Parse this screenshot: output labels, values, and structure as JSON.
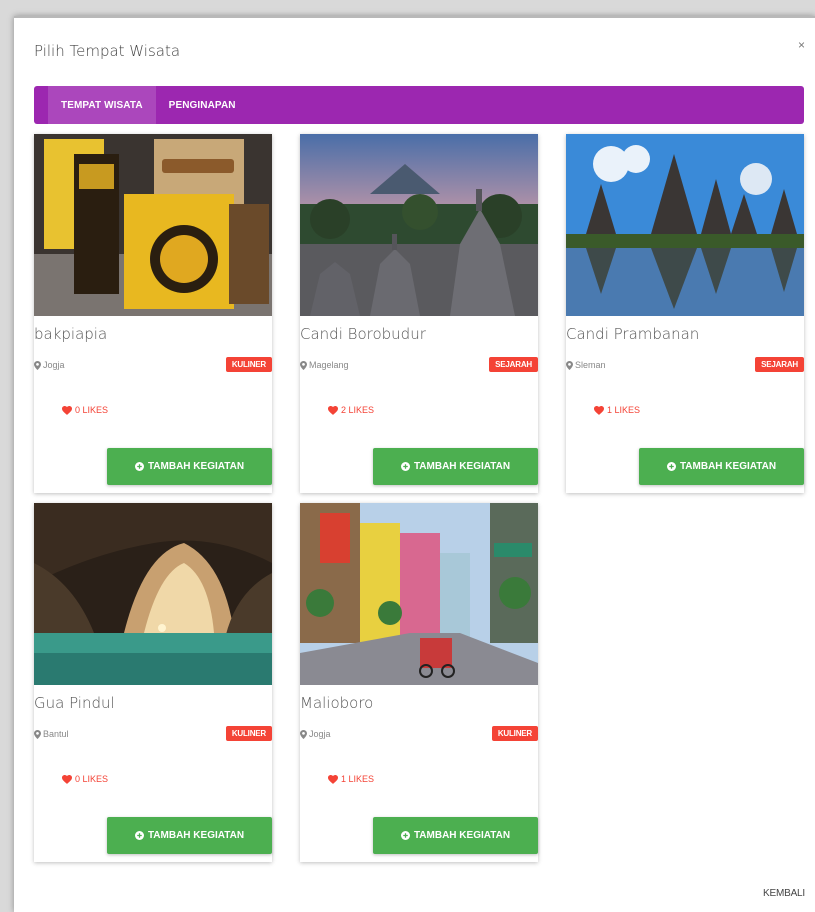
{
  "modal": {
    "title": "Pilih Tempat Wisata",
    "close": "×",
    "footer_button": "KEMBALI"
  },
  "tabs": [
    {
      "label": "TEMPAT WISATA",
      "active": true
    },
    {
      "label": "PENGINAPAN",
      "active": false
    }
  ],
  "cards": [
    {
      "name": "bakpiapia",
      "location": "Jogja",
      "category": "KULINER",
      "likes": "0 LIKES",
      "button": "TAMBAH KEGIATAN"
    },
    {
      "name": "Candi Borobudur",
      "location": "Magelang",
      "category": "SEJARAH",
      "likes": "2 LIKES",
      "button": "TAMBAH KEGIATAN"
    },
    {
      "name": "Candi Prambanan",
      "location": "Sleman",
      "category": "SEJARAH",
      "likes": "1 LIKES",
      "button": "TAMBAH KEGIATAN"
    },
    {
      "name": "Gua Pindul",
      "location": "Bantul",
      "category": "KULINER",
      "likes": "0 LIKES",
      "button": "TAMBAH KEGIATAN"
    },
    {
      "name": "Malioboro",
      "location": "Jogja",
      "category": "KULINER",
      "likes": "1 LIKES",
      "button": "TAMBAH KEGIATAN"
    }
  ],
  "colors": {
    "tab_bar": "#9c27b0",
    "badge": "#f44336",
    "button": "#4caf50",
    "likes": "#f44336"
  }
}
